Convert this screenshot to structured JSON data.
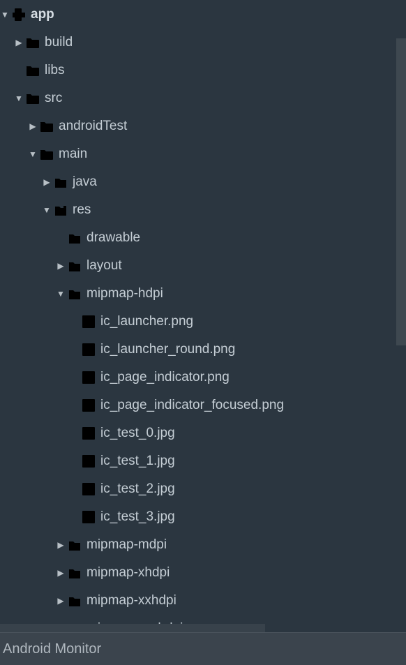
{
  "tree": {
    "app": "app",
    "build": "build",
    "libs": "libs",
    "src": "src",
    "androidTest": "androidTest",
    "main": "main",
    "java": "java",
    "res": "res",
    "drawable": "drawable",
    "layout": "layout",
    "mipmap_hdpi": "mipmap-hdpi",
    "files": {
      "f0": "ic_launcher.png",
      "f1": "ic_launcher_round.png",
      "f2": "ic_page_indicator.png",
      "f3": "ic_page_indicator_focused.png",
      "f4": "ic_test_0.jpg",
      "f5": "ic_test_1.jpg",
      "f6": "ic_test_2.jpg",
      "f7": "ic_test_3.jpg"
    },
    "mipmap_mdpi": "mipmap-mdpi",
    "mipmap_xhdpi": "mipmap-xhdpi",
    "mipmap_xxhdpi": "mipmap-xxhdpi",
    "mipmap_xxxhdpi": "mipmap-xxxhdpi"
  },
  "bottom": {
    "monitor": "Android Monitor"
  }
}
